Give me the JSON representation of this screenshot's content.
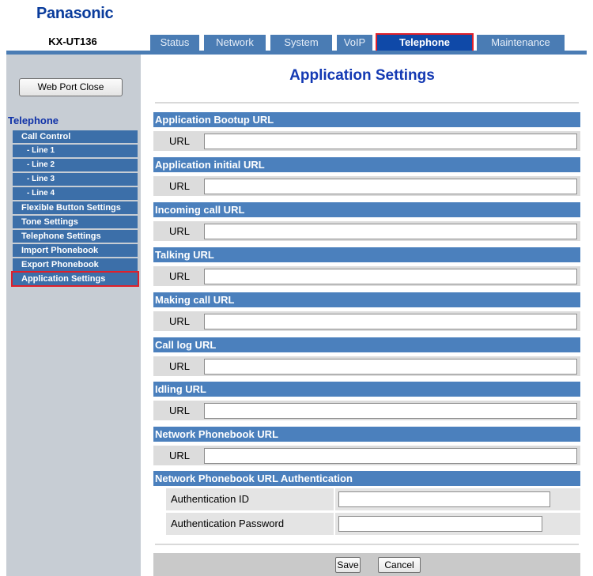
{
  "brand": "Panasonic",
  "model": "KX-UT136",
  "tabs": [
    "Status",
    "Network",
    "System",
    "VoIP",
    "Telephone",
    "Maintenance"
  ],
  "active_tab": "Telephone",
  "sidebar": {
    "web_port_button": "Web Port Close",
    "title": "Telephone",
    "items": [
      "Call Control",
      "- Line 1",
      "- Line 2",
      "- Line 3",
      "- Line 4",
      "Flexible Button Settings",
      "Tone Settings",
      "Telephone Settings",
      "Import Phonebook",
      "Export Phonebook",
      "Application Settings"
    ],
    "active_item": "Application Settings"
  },
  "main": {
    "title": "Application Settings",
    "sections": [
      {
        "header": "Application Bootup URL",
        "label": "URL",
        "value": ""
      },
      {
        "header": "Application initial URL",
        "label": "URL",
        "value": ""
      },
      {
        "header": "Incoming call URL",
        "label": "URL",
        "value": ""
      },
      {
        "header": "Talking URL",
        "label": "URL",
        "value": ""
      },
      {
        "header": "Making call URL",
        "label": "URL",
        "value": ""
      },
      {
        "header": "Call log URL",
        "label": "URL",
        "value": ""
      },
      {
        "header": "Idling URL",
        "label": "URL",
        "value": ""
      },
      {
        "header": "Network Phonebook URL",
        "label": "URL",
        "value": ""
      }
    ],
    "auth": {
      "header": "Network Phonebook URL Authentication",
      "id_label": "Authentication ID",
      "id_value": "",
      "password_label": "Authentication Password",
      "password_value": ""
    },
    "save_label": "Save",
    "cancel_label": "Cancel"
  },
  "colors": {
    "brand": "#0a3c9c",
    "tab": "#4a7cb4",
    "tab_active": "#0f49a8",
    "section_header": "#4b80bd",
    "highlight": "#e0202a"
  }
}
